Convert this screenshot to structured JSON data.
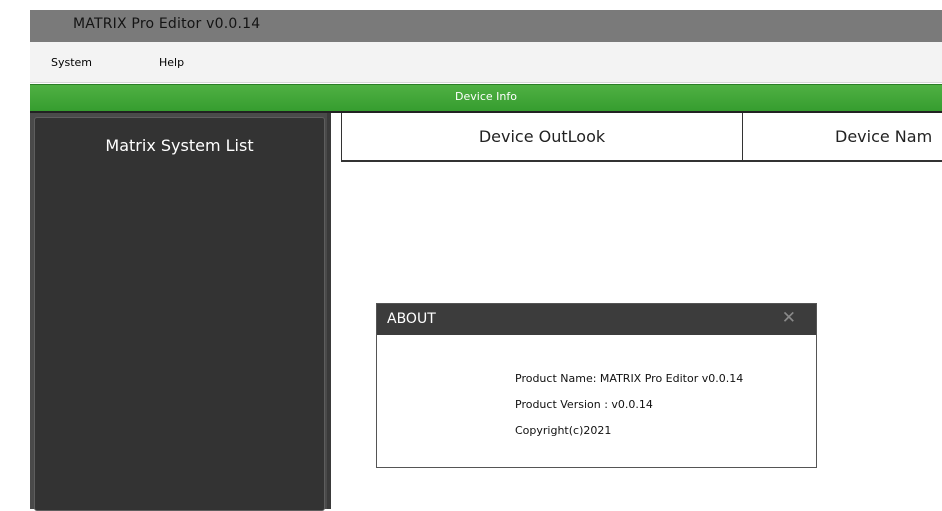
{
  "window": {
    "title": "MATRIX Pro Editor v0.0.14"
  },
  "menu": {
    "system_label": "System",
    "help_label": "Help"
  },
  "device_info_bar": {
    "label": "Device Info"
  },
  "sidebar": {
    "heading": "Matrix System List"
  },
  "tabs": [
    {
      "label": "Device OutLook"
    },
    {
      "label": "Device Nam"
    }
  ],
  "about_dialog": {
    "title": "ABOUT",
    "close_icon": "close-icon",
    "product_name": "Product Name: MATRIX Pro Editor v0.0.14",
    "product_version": "Product Version : v0.0.14",
    "copyright": "Copyright(c)2021"
  },
  "colors": {
    "title_bar": "#7a7a7a",
    "accent_green": "#43a73a",
    "sidebar_bg": "#333333",
    "dialog_title_bg": "#3c3c3c"
  }
}
